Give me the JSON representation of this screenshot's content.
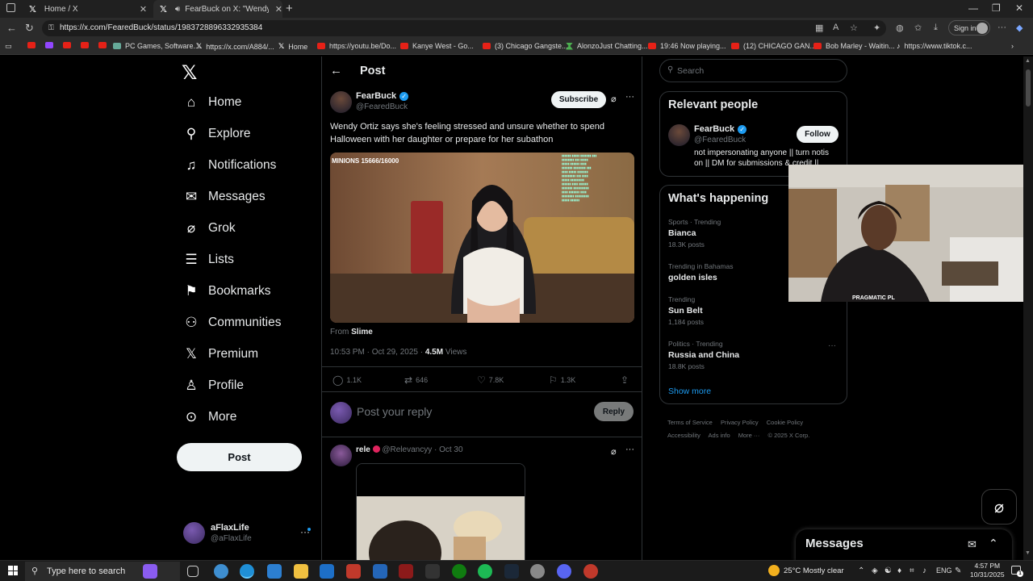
{
  "browser": {
    "tabs": [
      {
        "title": "Home / X"
      },
      {
        "title": "FearBuck on X: \"Wendy Ortiz"
      }
    ],
    "url": "https://x.com/FearedBuck/status/1983728896332935384",
    "sign_in": "Sign in",
    "favorites": [
      "PC Games, Software...",
      "https://x.com/A884/...",
      "Home",
      "https://youtu.be/Do...",
      "Kanye West - Go...",
      "(3) Chicago Gangste...",
      "AlonzoJust Chatting...",
      "19:46 Now playing...",
      "(12) CHICAGO GAN...",
      "Bob Marley - Waitin...",
      "https://www.tiktok.c..."
    ]
  },
  "nav": {
    "items": [
      {
        "label": "Home"
      },
      {
        "label": "Explore"
      },
      {
        "label": "Notifications"
      },
      {
        "label": "Messages"
      },
      {
        "label": "Grok"
      },
      {
        "label": "Lists"
      },
      {
        "label": "Bookmarks"
      },
      {
        "label": "Communities"
      },
      {
        "label": "Premium"
      },
      {
        "label": "Profile"
      },
      {
        "label": "More"
      }
    ],
    "post_button": "Post",
    "account": {
      "name": "aFlaxLife",
      "handle": "@aFlaxLife"
    }
  },
  "main": {
    "title": "Post",
    "post": {
      "author": "FearBuck",
      "handle": "@FearedBuck",
      "subscribe": "Subscribe",
      "text": "Wendy Ortiz says she's feeling stressed and unsure whether to spend Halloween with her daughter or prepare for her subathon",
      "media_overlay": "MINIONS 15666/16000",
      "from_label": "From",
      "from_source": "Slime",
      "time": "10:53 PM · Oct 29, 2025 ·",
      "views_count": "4.5M",
      "views_label": "Views",
      "stats": {
        "replies": "1.1K",
        "reposts": "646",
        "likes": "7.8K",
        "bookmarks": "1.3K"
      }
    },
    "reply_placeholder": "Post your reply",
    "reply_button": "Reply",
    "comment": {
      "name": "rele",
      "handle": "@Relevancyy",
      "date": "Oct 30"
    }
  },
  "right": {
    "search_placeholder": "Search",
    "relevant": {
      "title": "Relevant people",
      "name": "FearBuck",
      "handle": "@FearedBuck",
      "follow": "Follow",
      "bio": "not impersonating anyone || turn notis on || DM for submissions & credit ||"
    },
    "trending": {
      "title": "What's happening",
      "items": [
        {
          "context": "Sports · Trending",
          "name": "Bianca",
          "count": "18.3K posts"
        },
        {
          "context": "Trending in Bahamas",
          "name": "golden isles",
          "count": ""
        },
        {
          "context": "Trending",
          "name": "Sun Belt",
          "count": "1,184 posts"
        },
        {
          "context": "Politics · Trending",
          "name": "Russia and China",
          "count": "18.8K posts"
        }
      ],
      "show_more": "Show more"
    },
    "footer": [
      "Terms of Service",
      "Privacy Policy",
      "Cookie Policy",
      "Accessibility",
      "Ads info",
      "More ···",
      "© 2025 X Corp."
    ]
  },
  "overlay": {
    "cam_label": "PRAGMATIC PL"
  },
  "messages_drawer": {
    "title": "Messages"
  },
  "taskbar": {
    "search_placeholder": "Type here to search",
    "weather": "25°C  Mostly clear",
    "lang": "ENG",
    "time": "4:57 PM",
    "date": "10/31/2025",
    "notif_count": "1"
  },
  "colors": {
    "accent": "#1d9bf0",
    "background": "#000000",
    "border": "#2f3336",
    "muted": "#71767b"
  },
  "icons": [
    "x-logo-icon",
    "home-icon",
    "search-icon",
    "bell-icon",
    "mail-icon",
    "grok-icon",
    "list-icon",
    "bookmark-icon",
    "people-icon",
    "profile-icon",
    "more-circle-icon"
  ]
}
